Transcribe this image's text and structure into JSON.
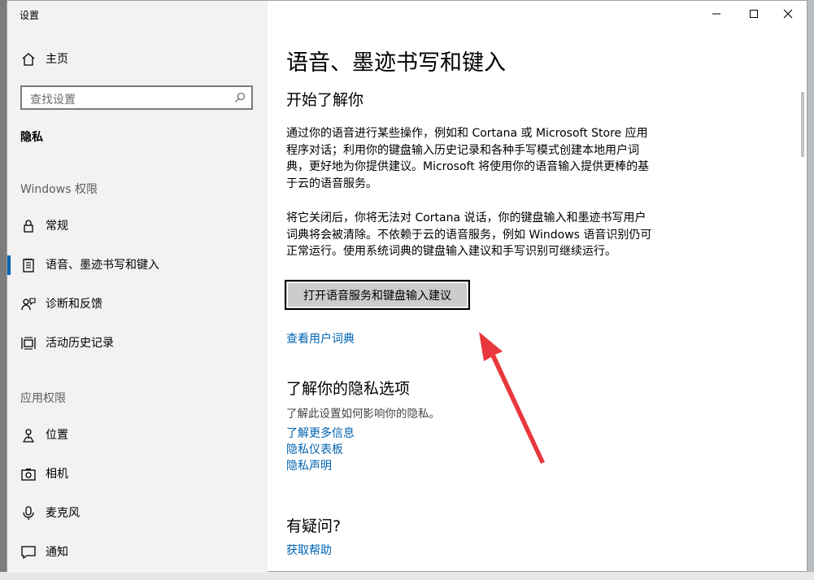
{
  "window": {
    "title": "设置"
  },
  "sidebar": {
    "home_label": "主页",
    "search_placeholder": "查找设置",
    "current_section": "隐私",
    "windows_permissions_label": "Windows 权限",
    "windows_items": [
      {
        "label": "常规",
        "icon": "lock-icon"
      },
      {
        "label": "语音、墨迹书写和键入",
        "icon": "notepad-icon",
        "active": true
      },
      {
        "label": "诊断和反馈",
        "icon": "feedback-icon"
      },
      {
        "label": "活动历史记录",
        "icon": "timeline-icon"
      }
    ],
    "app_permissions_label": "应用权限",
    "app_items": [
      {
        "label": "位置",
        "icon": "location-icon"
      },
      {
        "label": "相机",
        "icon": "camera-icon"
      },
      {
        "label": "麦克风",
        "icon": "microphone-icon"
      },
      {
        "label": "通知",
        "icon": "notification-icon"
      }
    ]
  },
  "main": {
    "title": "语音、墨迹书写和键入",
    "getting_to_know_heading": "开始了解你",
    "para1": "通过你的语音进行某些操作，例如和 Cortana 或 Microsoft Store 应用程序对话；利用你的键盘输入历史记录和各种手写模式创建本地用户词典，更好地为你提供建议。Microsoft 将使用你的语音输入提供更棒的基于云的语音服务。",
    "para2": "将它关闭后，你将无法对 Cortana 说话，你的键盘输入和墨迹书写用户词典将会被清除。不依赖于云的语音服务，例如 Windows 语音识别仍可正常运行。使用系统词典的键盘输入建议和手写识别可继续运行。",
    "toggle_button": "打开语音服务和键盘输入建议",
    "view_dictionary_link": "查看用户词典",
    "privacy_heading": "了解你的隐私选项",
    "privacy_desc": "了解此设置如何影响你的隐私。",
    "privacy_links": [
      "了解更多信息",
      "隐私仪表板",
      "隐私声明"
    ],
    "question_heading": "有疑问?",
    "help_link": "获取帮助"
  },
  "colors": {
    "accent": "#0063b1",
    "sidebar_bg": "#f2f2f2",
    "annotation_arrow": "#e8383d"
  }
}
